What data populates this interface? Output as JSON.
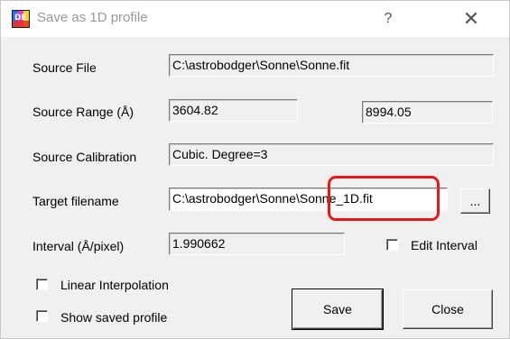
{
  "window": {
    "title": "Save as 1D profile",
    "help_glyph": "?",
    "close_glyph": "✕",
    "icon": "app-logo-icon"
  },
  "source_file": {
    "label": "Source File",
    "value": "C:\\astrobodger\\Sonne\\Sonne.fit"
  },
  "source_range": {
    "label": "Source Range (Å)",
    "min": "3604.82",
    "max": "8994.05"
  },
  "source_calibration": {
    "label": "Source Calibration",
    "value": "Cubic. Degree=3"
  },
  "target_filename": {
    "label": "Target filename",
    "value": "C:\\astrobodger\\Sonne\\Sonne_1D.fit",
    "browse_label": "..."
  },
  "interval": {
    "label": "Interval (Å/pixel)",
    "value": "1.990662",
    "edit_label": "Edit Interval",
    "edit_checked": false
  },
  "options": {
    "linear_interpolation_label": "Linear Interpolation",
    "linear_interpolation_checked": false,
    "show_saved_profile_label": "Show saved profile",
    "show_saved_profile_checked": false
  },
  "buttons": {
    "save_label": "Save",
    "close_label": "Close"
  },
  "colors": {
    "highlight": "#e8171a",
    "background": "#f0f0f0"
  }
}
